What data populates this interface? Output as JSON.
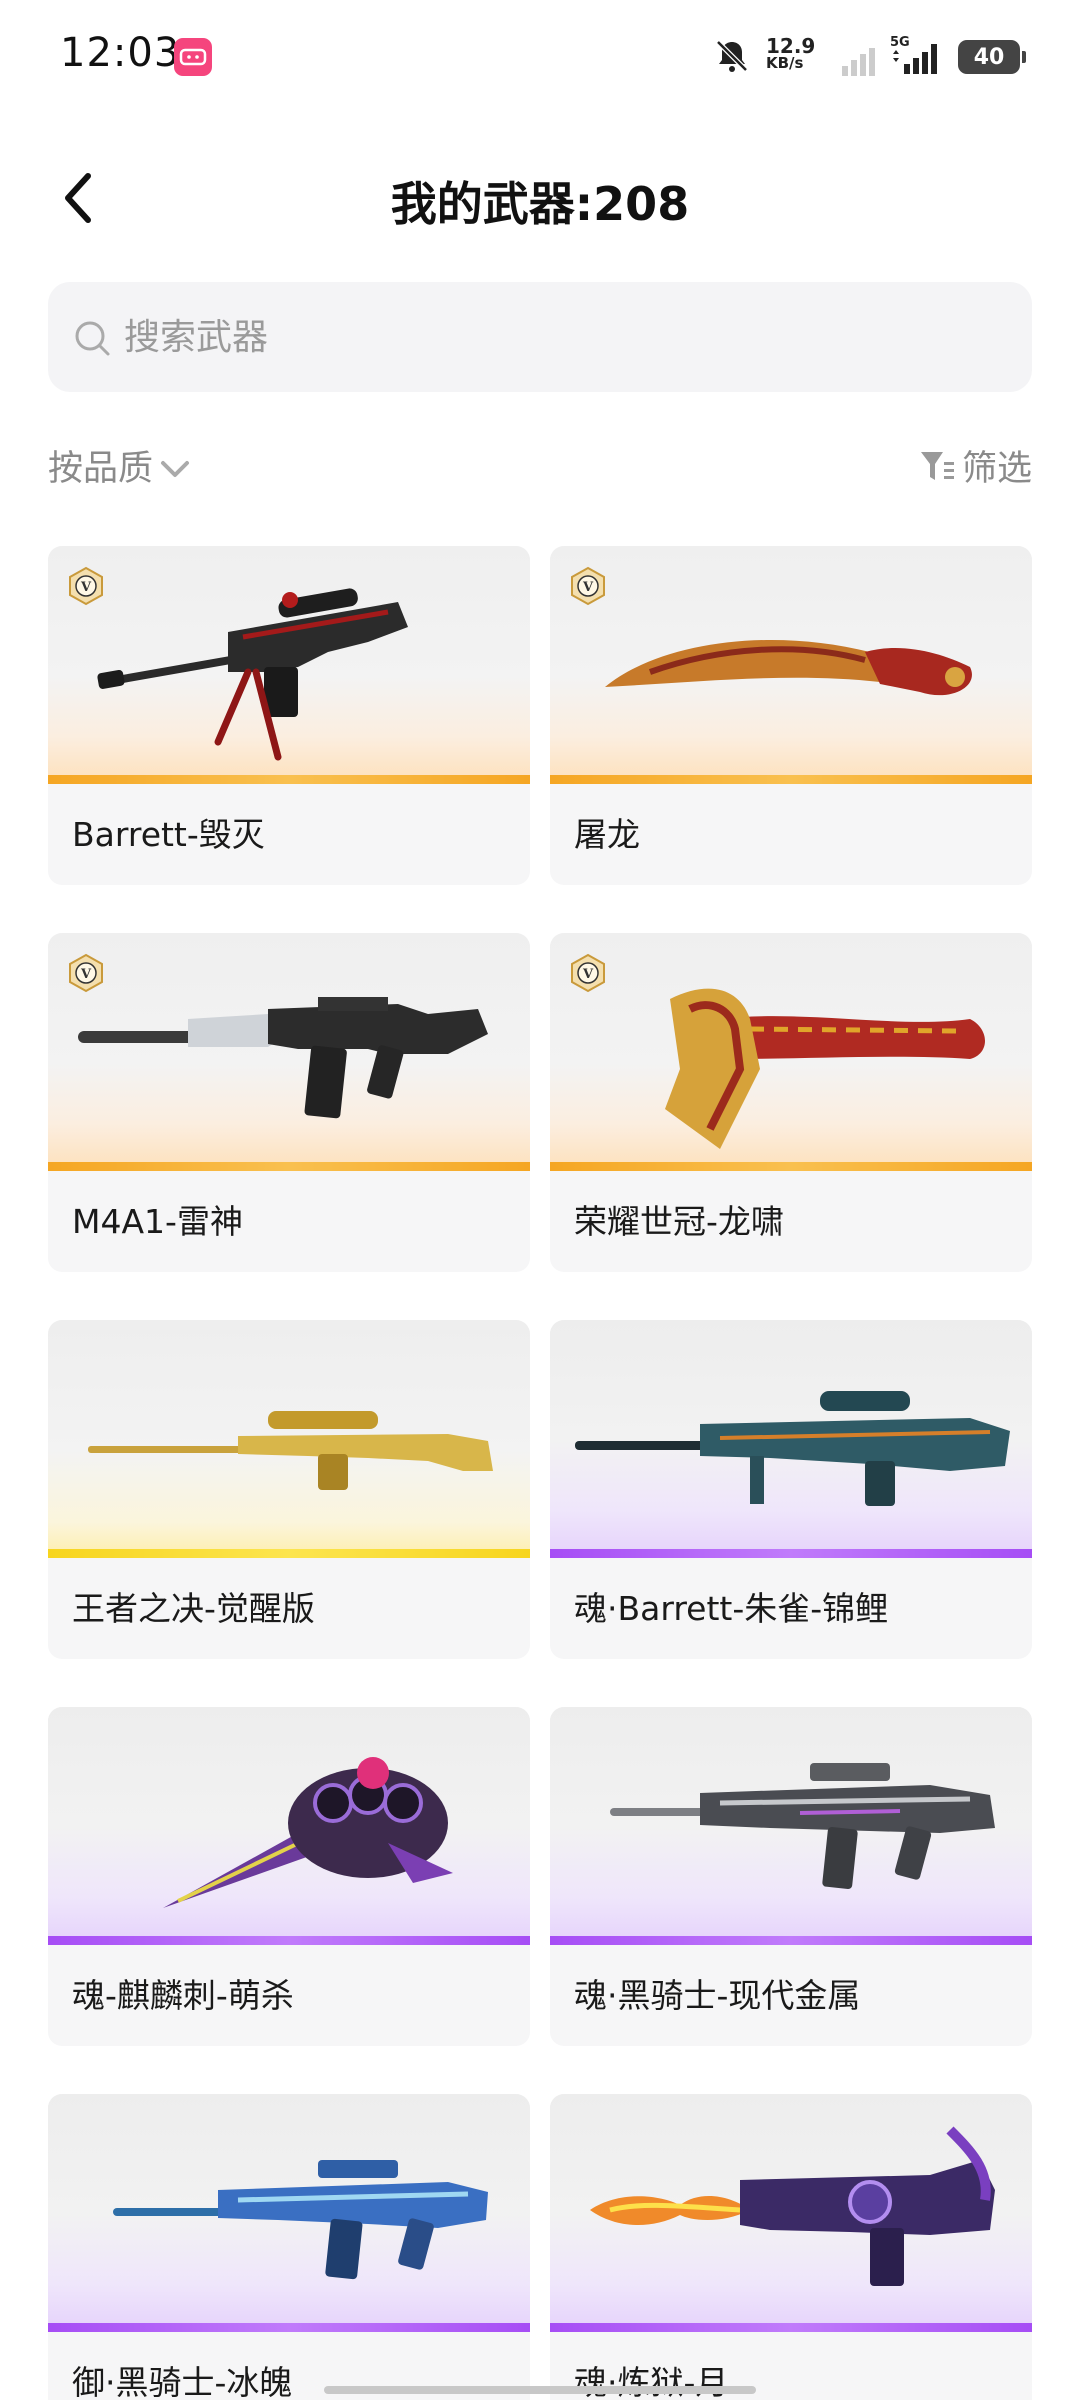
{
  "status_bar": {
    "time": "12:03",
    "net_speed_value": "12.9",
    "net_speed_unit": "KB/s",
    "network": "5G",
    "battery": "40",
    "icons": [
      "app-badge-icon",
      "mute-bell-icon",
      "signal-icon",
      "battery-icon"
    ]
  },
  "header": {
    "title": "我的武器:208",
    "back_icon": "chevron-left-icon"
  },
  "search": {
    "placeholder": "搜索武器",
    "value": ""
  },
  "toolbar": {
    "sort_label": "按品质",
    "filter_label": "筛选"
  },
  "colors": {
    "gold": "#f5a623",
    "yellow": "#f7d51e",
    "purple": "#a64df5",
    "card_bg": "#f6f6f7"
  },
  "weapons": [
    {
      "name": "Barrett-毁灭",
      "tier": "gold",
      "vip": true
    },
    {
      "name": "屠龙",
      "tier": "gold",
      "vip": true
    },
    {
      "name": "M4A1-雷神",
      "tier": "gold",
      "vip": true
    },
    {
      "name": "荣耀世冠-龙啸",
      "tier": "gold",
      "vip": true
    },
    {
      "name": "王者之决-觉醒版",
      "tier": "yellow",
      "vip": false
    },
    {
      "name": "魂·Barrett-朱雀-锦鲤",
      "tier": "purple",
      "vip": false
    },
    {
      "name": "魂-麒麟刺-萌杀",
      "tier": "purple",
      "vip": false
    },
    {
      "name": "魂·黑骑士-现代金属",
      "tier": "purple",
      "vip": false
    },
    {
      "name": "御·黑骑士-冰魄",
      "tier": "purple",
      "vip": false
    },
    {
      "name": "魂·炼狱-月",
      "tier": "purple",
      "vip": false
    }
  ]
}
